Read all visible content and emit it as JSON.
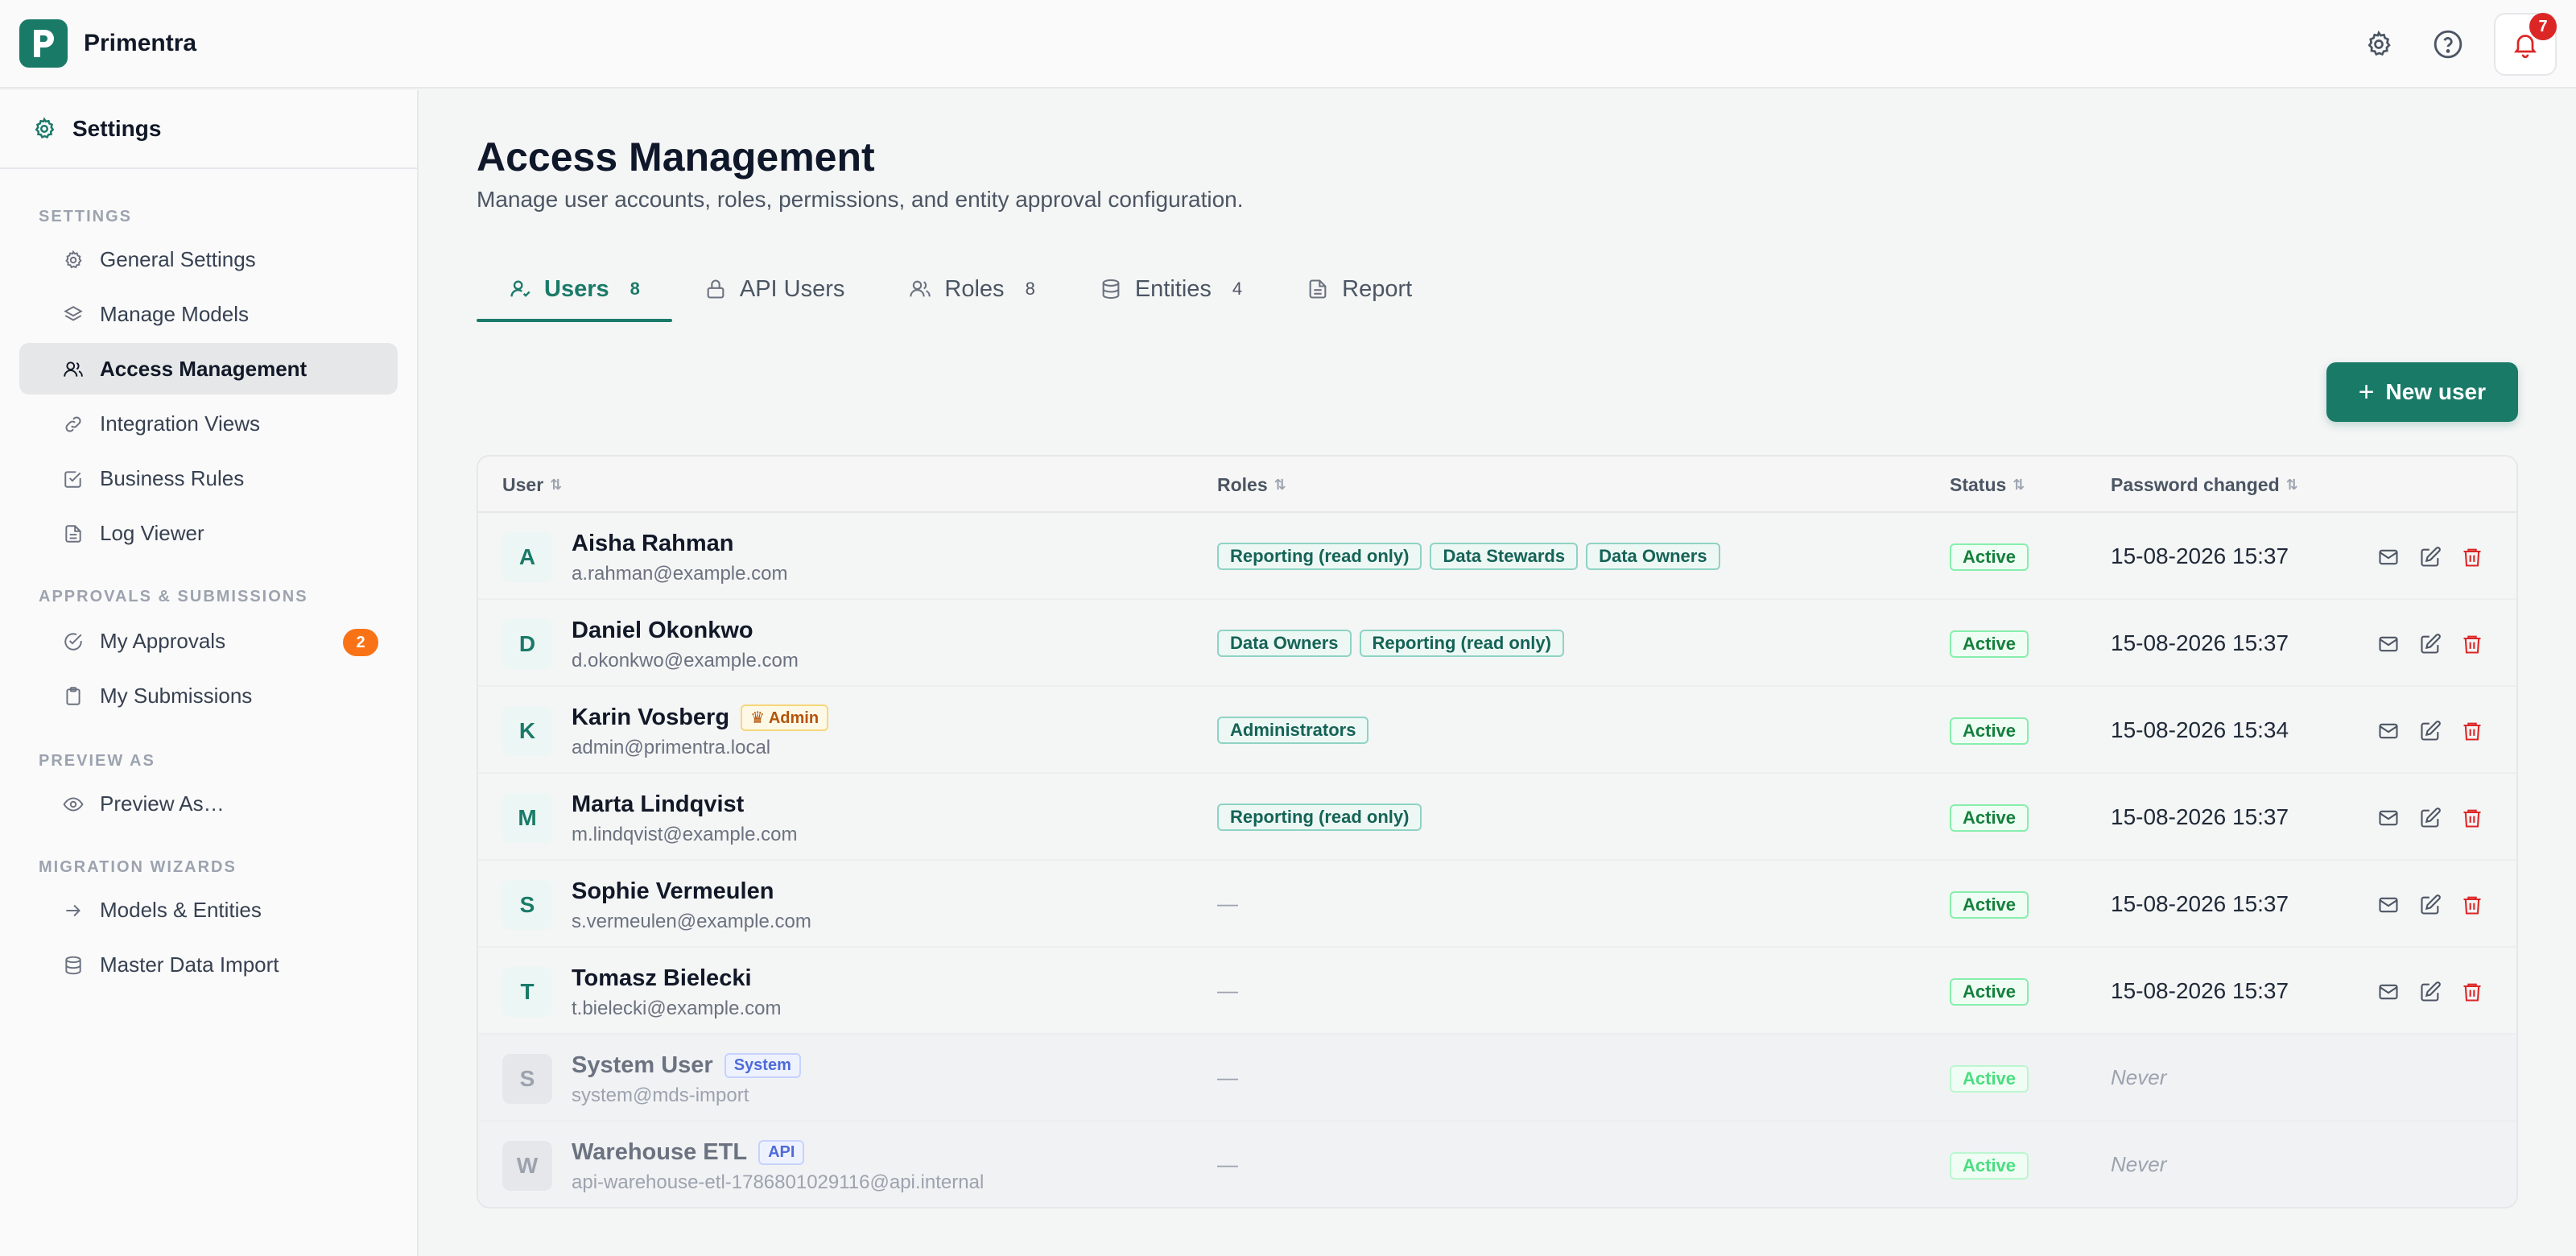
{
  "app": {
    "name": "Primentra"
  },
  "topbar": {
    "notification_count": "7"
  },
  "sidebar": {
    "title": "Settings",
    "sections": {
      "settings": "SETTINGS",
      "approvals": "APPROVALS & SUBMISSIONS",
      "preview": "PREVIEW AS",
      "migration": "MIGRATION WIZARDS"
    },
    "items": {
      "general_settings": "General Settings",
      "manage_models": "Manage Models",
      "access_management": "Access Management",
      "integration_views": "Integration Views",
      "business_rules": "Business Rules",
      "log_viewer": "Log Viewer",
      "my_approvals": "My Approvals",
      "my_approvals_count": "2",
      "my_submissions": "My Submissions",
      "preview_as": "Preview As…",
      "models_entities": "Models & Entities",
      "master_data_import": "Master Data Import"
    }
  },
  "page": {
    "title": "Access Management",
    "subtitle": "Manage user accounts, roles, permissions, and entity approval configuration."
  },
  "tabs": [
    {
      "label": "Users",
      "count": "8",
      "icon": "user-icon"
    },
    {
      "label": "API Users",
      "count": "",
      "icon": "lock-icon"
    },
    {
      "label": "Roles",
      "count": "8",
      "icon": "users-icon"
    },
    {
      "label": "Entities",
      "count": "4",
      "icon": "database-icon"
    },
    {
      "label": "Report",
      "count": "",
      "icon": "file-icon"
    }
  ],
  "toolbar": {
    "new_user_label": "New user"
  },
  "table": {
    "headers": {
      "user": "User",
      "roles": "Roles",
      "status": "Status",
      "password_changed": "Password changed"
    },
    "rows": [
      {
        "initial": "A",
        "name": "Aisha Rahman",
        "email": "a.rahman@example.com",
        "roles": [
          "Reporting (read only)",
          "Data Stewards",
          "Data Owners"
        ],
        "status": "Active",
        "password_changed": "15-08-2026 15:37"
      },
      {
        "initial": "D",
        "name": "Daniel Okonkwo",
        "email": "d.okonkwo@example.com",
        "roles": [
          "Data Owners",
          "Reporting (read only)"
        ],
        "status": "Active",
        "password_changed": "15-08-2026 15:37"
      },
      {
        "initial": "K",
        "name": "Karin Vosberg",
        "badge": "Admin",
        "email": "admin@primentra.local",
        "roles": [
          "Administrators"
        ],
        "status": "Active",
        "password_changed": "15-08-2026 15:34"
      },
      {
        "initial": "M",
        "name": "Marta Lindqvist",
        "email": "m.lindqvist@example.com",
        "roles": [
          "Reporting (read only)"
        ],
        "status": "Active",
        "password_changed": "15-08-2026 15:37"
      },
      {
        "initial": "S",
        "name": "Sophie Vermeulen",
        "email": "s.vermeulen@example.com",
        "roles_empty": "—",
        "status": "Active",
        "password_changed": "15-08-2026 15:37"
      },
      {
        "initial": "T",
        "name": "Tomasz Bielecki",
        "email": "t.bielecki@example.com",
        "roles_empty": "—",
        "status": "Active",
        "password_changed": "15-08-2026 15:37"
      },
      {
        "initial": "S",
        "name": "System User",
        "badge": "System",
        "email": "system@mds-import",
        "roles_empty": "—",
        "status": "Active",
        "password_changed": "Never"
      },
      {
        "initial": "W",
        "name": "Warehouse ETL",
        "badge": "API",
        "email": "api-warehouse-etl-1786801029116@api.internal",
        "roles_empty": "—",
        "status": "Active",
        "password_changed": "Never"
      }
    ]
  },
  "colors": {
    "accent": "#1a7a68",
    "danger": "#dc2626",
    "badge_orange": "#f97316"
  }
}
